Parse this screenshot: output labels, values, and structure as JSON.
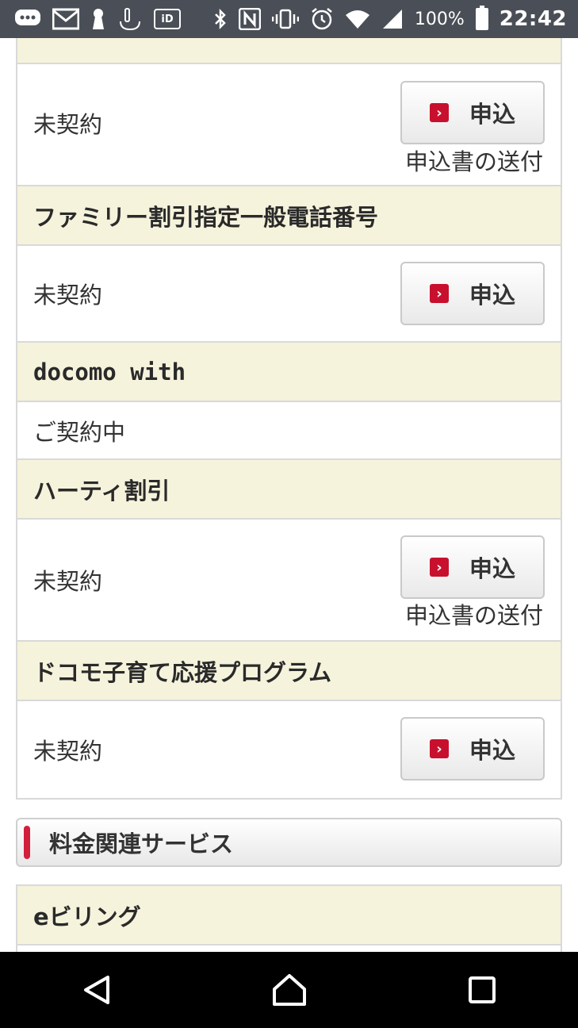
{
  "status_bar": {
    "time": "22:42",
    "battery_percent": "100%",
    "left_icons": [
      "message-icon",
      "mail-icon",
      "keyhole-icon",
      "touch-icon",
      "id-icon"
    ],
    "id_label": "iD",
    "right_icons": [
      "bluetooth-icon",
      "nfc-icon",
      "vibrate-icon",
      "alarm-icon",
      "wifi-icon",
      "signal-icon",
      "battery-icon"
    ]
  },
  "rows": {
    "family_body": {
      "status": "未契約",
      "apply_label": "申込",
      "send_label": "申込書の送付"
    },
    "family_landline": {
      "title": "ファミリー割引指定一般電話番号",
      "status": "未契約",
      "apply_label": "申込"
    },
    "docomo_with": {
      "title": "docomo with",
      "status": "ご契約中"
    },
    "party": {
      "title": "ハーティ割引",
      "status": "未契約",
      "apply_label": "申込",
      "send_label": "申込書の送付"
    },
    "kosodate": {
      "title": "ドコモ子育て応援プログラム",
      "status": "未契約",
      "apply_label": "申込"
    }
  },
  "section": {
    "title": "料金関連サービス"
  },
  "ebilling": {
    "title": "eビリング"
  },
  "colors": {
    "header_bg": "#f6f3dc",
    "accent_red": "#c8102e",
    "border": "#d9d9d9"
  }
}
